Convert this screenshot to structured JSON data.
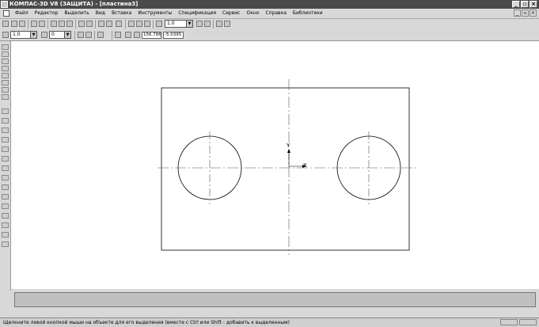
{
  "window": {
    "title": "КОМПАС-3D V8 (ЗАЩИТА) - [пластина3]"
  },
  "menu": [
    "Файл",
    "Редактор",
    "Выделить",
    "Вид",
    "Вставка",
    "Инструменты",
    "Спецификация",
    "Сервис",
    "Окно",
    "Справка",
    "Библиотеки"
  ],
  "toolbar1": {
    "scale_value": "1.0"
  },
  "toolbar2": {
    "step_value": "1.0",
    "layer_value": "0",
    "coord_x": "156.786",
    "coord_y": "-5.0395"
  },
  "status": {
    "hint": "Щелкните левой кнопкой мыши на объекте для его выделения (вместе с Ctrl или Shift - добавить к выделенным)"
  },
  "drawing": {
    "axis_x_label": "X",
    "axis_y_label": "Y"
  }
}
